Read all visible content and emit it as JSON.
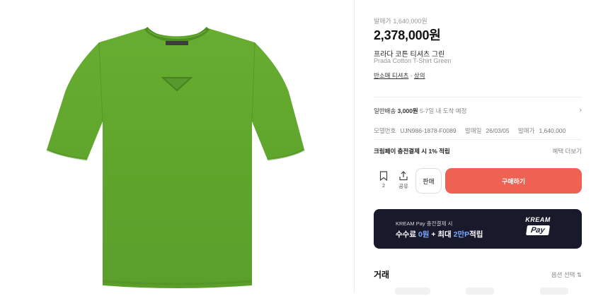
{
  "product": {
    "release_price": "발매가 1,640,000원",
    "price": "2,378,000원",
    "name_ko": "프라다 코튼 티셔츠 그린",
    "name_en": "Prada Cotton T-Shirt Green",
    "tags": [
      "반소매 티셔츠",
      "상의"
    ],
    "image_color": "#5fa82d"
  },
  "shipping": {
    "label": "일반배송",
    "fee": "3,000원",
    "eta": "5-7일 내 도착 예정"
  },
  "details": {
    "model_label": "모델번호",
    "model_value": "UJN986-1878-F0089",
    "release_date_label": "발매일",
    "release_date_value": "26/03/05",
    "release_price_label": "발매가",
    "release_price_value": "1,640,000"
  },
  "benefit": {
    "text": "크림페이 충전결제 시 1% 적립",
    "more": "혜택 더보기"
  },
  "actions": {
    "wishlist_count": "2",
    "share_label": "공유",
    "sell_label": "판매",
    "buy_label": "구매하기"
  },
  "pay_banner": {
    "small": "KREAM Pay 충전결제 시",
    "big_prefix": "수수료 ",
    "big_hl1": "0원",
    "big_mid": " + 최대 ",
    "big_hl2": "2만P",
    "big_suffix": "적립",
    "logo_top": "KREAM",
    "logo_pay": "Pay"
  },
  "trade": {
    "title": "거래",
    "option": "옵션 선택 ⇅"
  },
  "colors": {
    "buy_button": "#ef6253",
    "banner_bg": "#181a2c",
    "highlight": "#7aa8ff"
  }
}
